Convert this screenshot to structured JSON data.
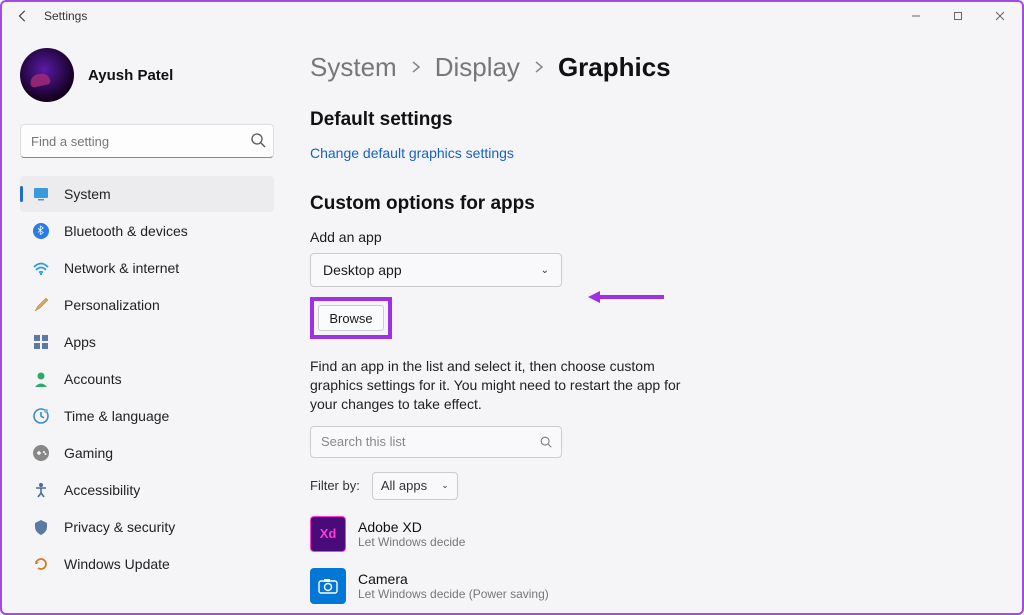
{
  "window": {
    "title": "Settings"
  },
  "profile": {
    "name": "Ayush Patel"
  },
  "search": {
    "placeholder": "Find a setting"
  },
  "nav": [
    {
      "id": "system",
      "label": "System"
    },
    {
      "id": "bluetooth",
      "label": "Bluetooth & devices"
    },
    {
      "id": "network",
      "label": "Network & internet"
    },
    {
      "id": "personalization",
      "label": "Personalization"
    },
    {
      "id": "apps",
      "label": "Apps"
    },
    {
      "id": "accounts",
      "label": "Accounts"
    },
    {
      "id": "time",
      "label": "Time & language"
    },
    {
      "id": "gaming",
      "label": "Gaming"
    },
    {
      "id": "accessibility",
      "label": "Accessibility"
    },
    {
      "id": "privacy",
      "label": "Privacy & security"
    },
    {
      "id": "update",
      "label": "Windows Update"
    }
  ],
  "breadcrumb": {
    "root": "System",
    "mid": "Display",
    "leaf": "Graphics"
  },
  "sections": {
    "default": {
      "title": "Default settings",
      "link": "Change default graphics settings"
    },
    "custom": {
      "title": "Custom options for apps",
      "add_label": "Add an app",
      "dropdown_value": "Desktop app",
      "browse_label": "Browse",
      "help": "Find an app in the list and select it, then choose custom graphics settings for it. You might need to restart the app for your changes to take effect.",
      "search_placeholder": "Search this list",
      "filter_label": "Filter by:",
      "filter_value": "All apps",
      "apps": [
        {
          "name": "Adobe XD",
          "sub": "Let Windows decide"
        },
        {
          "name": "Camera",
          "sub": "Let Windows decide (Power saving)"
        }
      ]
    }
  }
}
